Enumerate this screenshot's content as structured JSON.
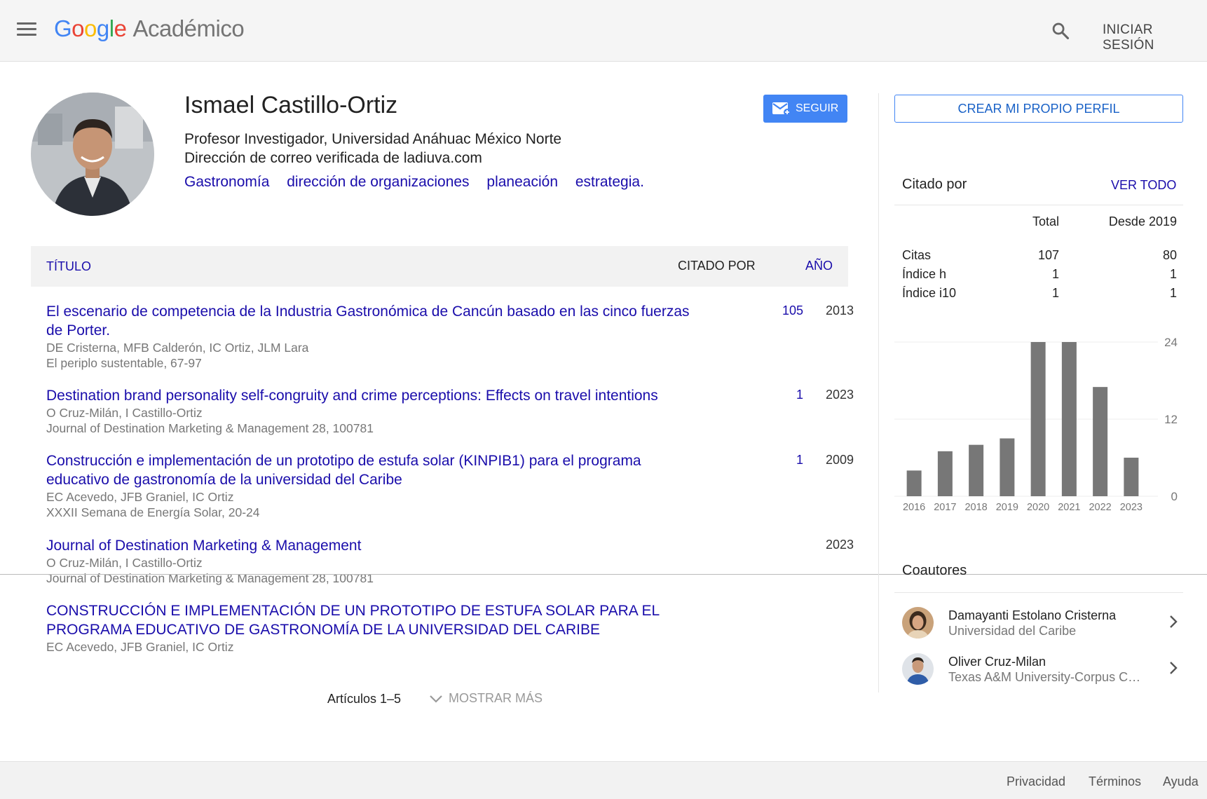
{
  "header": {
    "logo_google": [
      "G",
      "o",
      "o",
      "g",
      "l",
      "e"
    ],
    "logo_product": "Académico",
    "signin_label": "INICIAR SESIÓN",
    "icons": {
      "menu": "menu-icon",
      "search": "search-icon"
    }
  },
  "profile": {
    "name": "Ismael Castillo-Ortiz",
    "affiliation": "Profesor Investigador, Universidad Anáhuac México Norte",
    "email": "Dirección de correo verificada de ladiuva.com",
    "interests": [
      "Gastronomía",
      "dirección de organizaciones",
      "planeación",
      "estrategia."
    ],
    "follow_label": "SEGUIR"
  },
  "table": {
    "col_title": "TÍTULO",
    "col_cited": "CITADO POR",
    "col_year": "AÑO"
  },
  "articles": [
    {
      "title": "El escenario de competencia de la Industria Gastronómica de Cancún basado en las cinco fuerzas de Porter.",
      "authors": "DE Cristerna, MFB Calderón, IC Ortiz, JLM Lara",
      "venue": "El periplo sustentable, 67-97",
      "cited": "105",
      "year": "2013"
    },
    {
      "title": "Destination brand personality self-congruity and crime perceptions: Effects on travel intentions",
      "authors": "O Cruz-Milán, I Castillo-Ortiz",
      "venue": "Journal of Destination Marketing & Management 28, 100781",
      "cited": "1",
      "year": "2023"
    },
    {
      "title": "Construcción e implementación de un prototipo de estufa solar (KINPIB1) para el programa educativo de gastronomía de la universidad del Caribe",
      "authors": "EC Acevedo, JFB Graniel, IC Ortiz",
      "venue": "XXXII Semana de Energía Solar, 20-24",
      "cited": "1",
      "year": "2009"
    },
    {
      "title": "Journal of Destination Marketing & Management",
      "authors": "O Cruz-Milán, I Castillo-Ortiz",
      "venue": "Journal of Destination Marketing & Management 28, 100781",
      "cited": "",
      "year": "2023"
    },
    {
      "title": "CONSTRUCCIÓN E IMPLEMENTACIÓN DE UN PROTOTIPO DE ESTUFA SOLAR PARA EL PROGRAMA EDUCATIVO DE GASTRONOMÍA DE LA UNIVERSIDAD DEL CARIBE",
      "authors": "EC Acevedo, JFB Graniel, IC Ortiz",
      "venue": "",
      "cited": "",
      "year": ""
    }
  ],
  "pager": {
    "range_label": "Artículos 1–5",
    "show_more_label": "MOSTRAR MÁS"
  },
  "sidebar": {
    "create_profile_label": "CREAR MI PROPIO PERFIL",
    "cited_by_title": "Citado por",
    "view_all_label": "VER TODO",
    "stats_header": {
      "total": "Total",
      "since": "Desde 2019"
    },
    "stats": [
      {
        "label": "Citas",
        "total": "107",
        "since": "80"
      },
      {
        "label": "Índice h",
        "total": "1",
        "since": "1"
      },
      {
        "label": "Índice i10",
        "total": "1",
        "since": "1"
      }
    ],
    "coauthors_title": "Coautores",
    "coauthors": [
      {
        "name": "Damayanti Estolano Cristerna",
        "affiliation": "Universidad del Caribe"
      },
      {
        "name": "Oliver Cruz-Milan",
        "affiliation": "Texas A&M University-Corpus Christi"
      }
    ]
  },
  "chart_data": {
    "type": "bar",
    "categories": [
      "2016",
      "2017",
      "2018",
      "2019",
      "2020",
      "2021",
      "2022",
      "2023"
    ],
    "values": [
      4,
      7,
      8,
      9,
      24,
      24,
      17,
      6
    ],
    "ylim": [
      0,
      24
    ],
    "yticks": [
      0,
      12,
      24
    ],
    "bar_color": "#777777"
  },
  "footer": {
    "links": [
      "Privacidad",
      "Términos",
      "Ayuda"
    ]
  }
}
